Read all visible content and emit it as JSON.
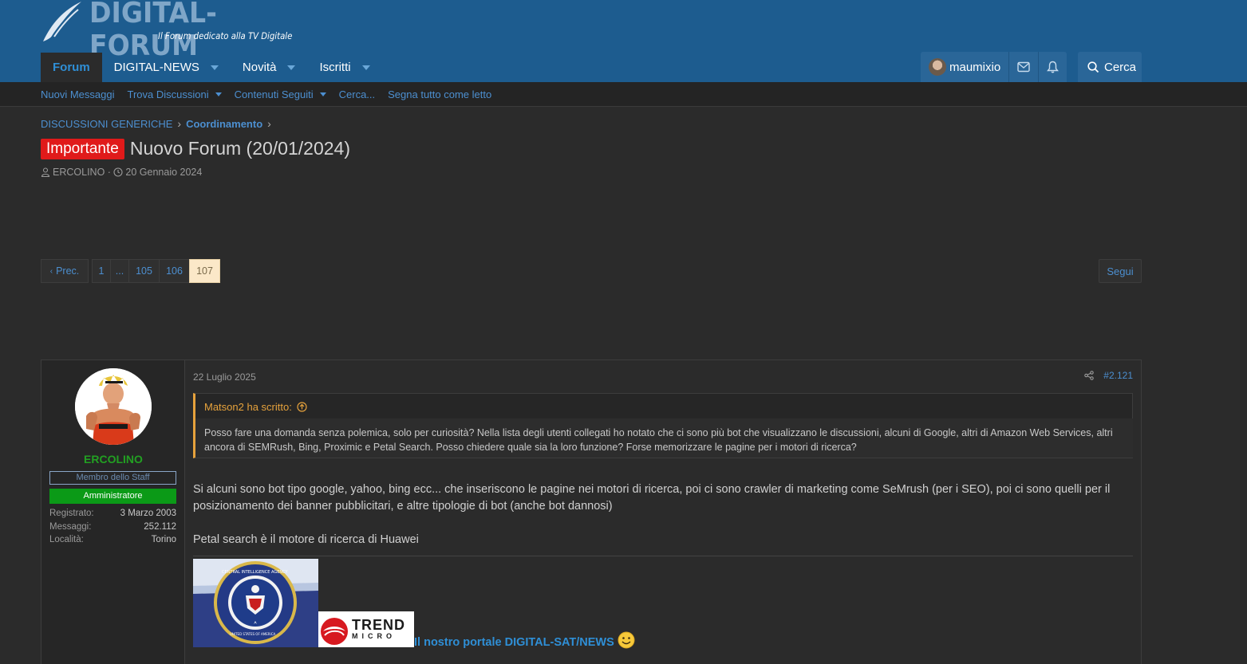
{
  "logo": {
    "text": "DIGITAL-FORUM",
    "subtitle": "Il Forum dedicato alla TV Digitale"
  },
  "nav": {
    "items": [
      {
        "label": "Forum",
        "active": true
      },
      {
        "label": "DIGITAL-NEWS",
        "dropdown": true
      },
      {
        "label": "Novità",
        "dropdown": true
      },
      {
        "label": "Iscritti",
        "dropdown": true
      }
    ]
  },
  "userbar": {
    "username": "maumixio",
    "search_label": "Cerca"
  },
  "subnav": {
    "items": [
      {
        "label": "Nuovi Messaggi"
      },
      {
        "label": "Trova Discussioni",
        "dropdown": true
      },
      {
        "label": "Contenuti Seguiti",
        "dropdown": true
      },
      {
        "label": "Cerca..."
      },
      {
        "label": "Segna tutto come letto"
      }
    ]
  },
  "breadcrumb": [
    "DISCUSSIONI GENERICHE",
    "Coordinamento"
  ],
  "thread": {
    "badge": "Importante",
    "title": "Nuovo Forum (20/01/2024)",
    "author": "ERCOLINO",
    "date": "20 Gennaio 2024"
  },
  "pagination": {
    "prev": "Prec.",
    "pages": [
      "1",
      "...",
      "105",
      "106",
      "107"
    ],
    "current": "107"
  },
  "follow_label": "Segui",
  "post": {
    "user": {
      "name": "ERCOLINO",
      "title": "Membro dello Staff",
      "role": "Amministratore",
      "stats": [
        {
          "key": "Registrato:",
          "value": "3 Marzo 2003"
        },
        {
          "key": "Messaggi:",
          "value": "252.112"
        },
        {
          "key": "Località:",
          "value": "Torino"
        }
      ]
    },
    "date": "22 Luglio 2025",
    "number": "#2.121",
    "quote": {
      "author": "Matson2 ha scritto:",
      "text": "Posso fare una domanda senza polemica, solo per curiosità? Nella lista degli utenti collegati ho notato che ci sono più bot che visualizzano le discussioni, alcuni di Google, altri di Amazon Web Services, altri ancora di SEMRush, Bing, Proximic e Petal Search. Posso chiedere quale sia la loro funzione? Forse memorizzare le pagine per i motori di ricerca?"
    },
    "paragraphs": [
      "Si alcuni sono bot tipo google, yahoo, bing ecc... che inseriscono le pagine nei motori di ricerca, poi ci sono crawler di marketing come SeMrush (per i SEO), poi ci sono quelli per il posizionamento dei banner pubblicitari, e altre tipologie di bot (anche bot dannosi)",
      "Petal search è il motore di ricerca di Huawei"
    ],
    "signature": {
      "cia_text": "CENTRAL INTELLIGENCE AGENCY",
      "cia_bottom": "UNITED STATES OF AMERICA",
      "trend_top": "TREND",
      "trend_bottom": "MICRO",
      "link": "Il nostro portale DIGITAL-SAT/NEWS"
    }
  },
  "colors": {
    "header": "#1d5c8f",
    "accent": "#2f8fd6",
    "badge": "#e01a1a",
    "role": "#0b9a17",
    "quote_border": "#e6a23c"
  }
}
